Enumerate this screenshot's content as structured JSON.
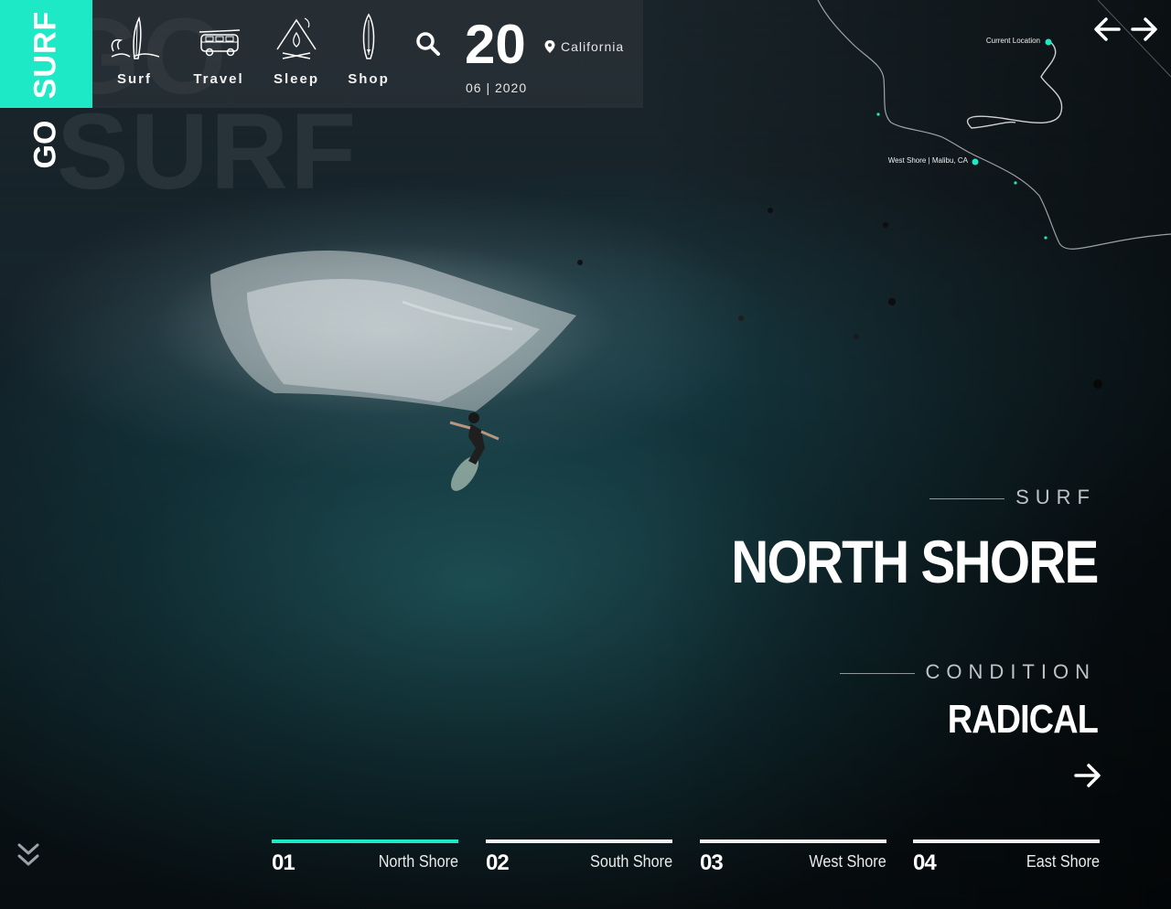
{
  "brand": {
    "word_top": "SURF",
    "word_bottom": "GO",
    "ghost_line1": "GO",
    "ghost_line2": "SURF"
  },
  "nav": {
    "items": [
      {
        "label": "Surf",
        "icon": "surfboard-wave-icon"
      },
      {
        "label": "Travel",
        "icon": "camper-van-icon"
      },
      {
        "label": "Sleep",
        "icon": "tent-campfire-icon"
      },
      {
        "label": "Shop",
        "icon": "surfboard-icon"
      }
    ],
    "search_icon": "search-icon"
  },
  "date": {
    "day": "20",
    "month_year": "06 | 2020"
  },
  "location": {
    "label": "California",
    "icon": "map-pin-icon"
  },
  "map": {
    "current_label": "Current Location",
    "spot_label": "West Shore | Malibu, CA",
    "accent": "#1de9c6"
  },
  "hero": {
    "kicker": "SURF",
    "title": "NORTH SHORE",
    "condition_label": "CONDITION",
    "condition_value": "RADICAL"
  },
  "tabs": [
    {
      "num": "01",
      "name": "North Shore",
      "active": true
    },
    {
      "num": "02",
      "name": "South Shore",
      "active": false
    },
    {
      "num": "03",
      "name": "West Shore",
      "active": false
    },
    {
      "num": "04",
      "name": "East Shore",
      "active": false
    }
  ],
  "colors": {
    "accent": "#1de9c6",
    "text": "#ffffff",
    "ocean_dark": "#0f1c22"
  }
}
